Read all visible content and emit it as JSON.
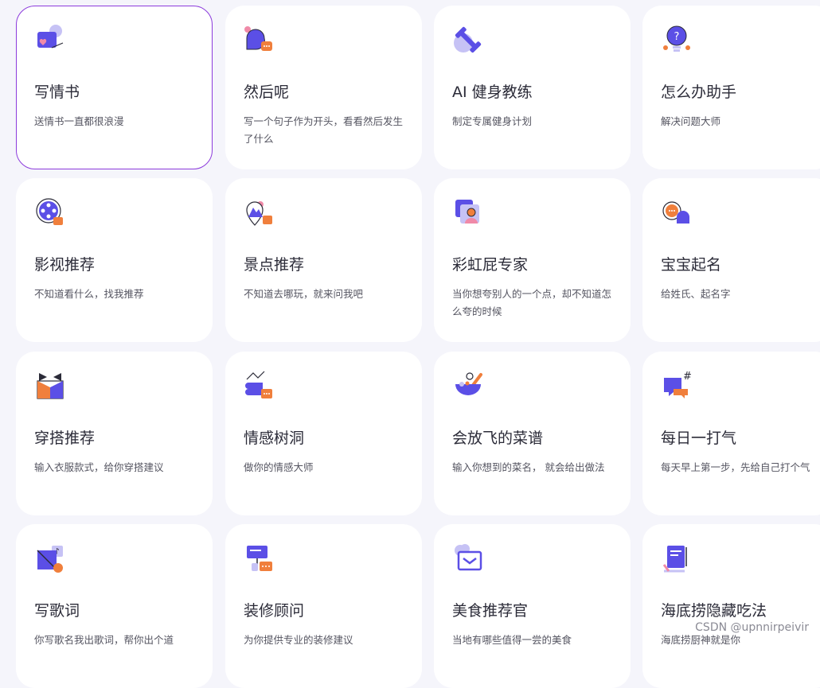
{
  "cards": [
    {
      "title": "写情书",
      "desc": "送情书一直都很浪漫",
      "icon": "love-letter-icon"
    },
    {
      "title": "然后呢",
      "desc": "写一个句子作为开头，看看然后发生了什么",
      "icon": "chat-bubble-icon"
    },
    {
      "title": "AI 健身教练",
      "desc": "制定专属健身计划",
      "icon": "dumbbell-icon"
    },
    {
      "title": "怎么办助手",
      "desc": "解决问题大师",
      "icon": "lightbulb-question-icon"
    },
    {
      "title": "影视推荐",
      "desc": "不知道看什么，找我推荐",
      "icon": "film-reel-icon"
    },
    {
      "title": "景点推荐",
      "desc": "不知道去哪玩，就来问我吧",
      "icon": "location-pin-icon"
    },
    {
      "title": "彩虹屁专家",
      "desc": "当你想夸别人的一个点，却不知道怎么夸的时候",
      "icon": "person-card-icon"
    },
    {
      "title": "宝宝起名",
      "desc": "给姓氏、起名字",
      "icon": "baby-chat-icon"
    },
    {
      "title": "穿搭推荐",
      "desc": "输入衣服款式，给你穿搭建议",
      "icon": "outfit-icon"
    },
    {
      "title": "情感树洞",
      "desc": "做你的情感大师",
      "icon": "heart-puzzle-icon"
    },
    {
      "title": "会放飞的菜谱",
      "desc": "输入你想到的菜名， 就会给出做法",
      "icon": "cooking-bowl-icon"
    },
    {
      "title": "每日一打气",
      "desc": "每天早上第一步，先给自己打个气",
      "icon": "hashtag-chat-icon"
    },
    {
      "title": "写歌词",
      "desc": "你写歌名我出歌词，帮你出个道",
      "icon": "music-note-icon"
    },
    {
      "title": "装修顾问",
      "desc": "为你提供专业的装修建议",
      "icon": "decor-chat-icon"
    },
    {
      "title": "美食推荐官",
      "desc": "当地有哪些值得一尝的美食",
      "icon": "food-mail-icon"
    },
    {
      "title": "海底捞隐藏吃法",
      "desc": "海底捞厨神就是你",
      "icon": "document-pen-icon"
    }
  ],
  "watermark": "CSDN @upnnirpeivir",
  "colors": {
    "primary": "#5b4fe6",
    "accent": "#f07f3c",
    "light_purple": "#c6c2f5",
    "pink": "#f08aa8",
    "selected_border": "#8c3bdc"
  }
}
